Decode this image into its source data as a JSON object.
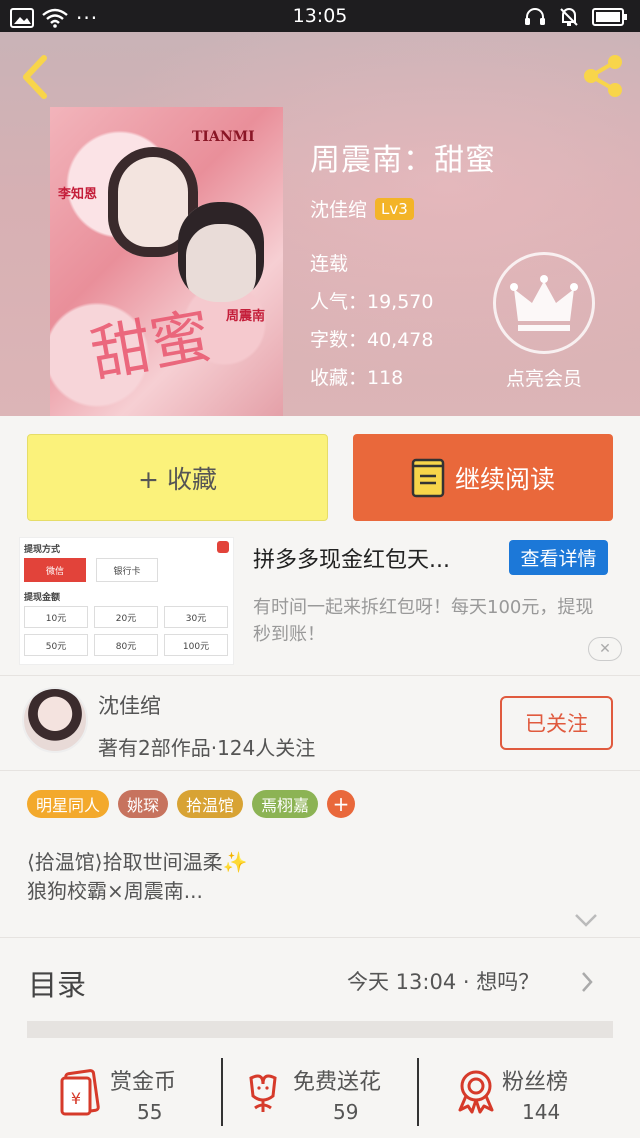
{
  "status_bar": {
    "time": "13:05",
    "dots": "···"
  },
  "book": {
    "title": "周震南：甜蜜",
    "author": "沈佳绾",
    "level": "Lv3",
    "status": "连载",
    "popularity": "人气：19,570",
    "word_count": "字数：40,478",
    "favorites": "收藏：118",
    "cover_texts": {
      "brand": "TIANMI",
      "name_left": "李知恩",
      "name_right": "周震南",
      "cover_title": "甜蜜"
    }
  },
  "vip": {
    "label": "点亮会员"
  },
  "actions": {
    "favorite_label": "+ 收藏",
    "read_label": "继续阅读"
  },
  "ad": {
    "title": "拼多多现金红包天...",
    "button": "查看详情",
    "description": "有时间一起来拆红包呀！每天100元，提现秒到账！",
    "close": "✕",
    "image": {
      "method_label": "提现方式",
      "wechat": "微信",
      "bank": "银行卡",
      "amount_label": "提现金额",
      "amounts": [
        "10元",
        "20元",
        "30元",
        "50元",
        "80元",
        "100元"
      ]
    }
  },
  "author_card": {
    "name": "沈佳绾",
    "stats": "著有2部作品·124人关注",
    "follow_label": "已关注"
  },
  "tags": [
    {
      "label": "明星同人",
      "color": "#f3a92c"
    },
    {
      "label": "姚琛",
      "color": "#c7735e"
    },
    {
      "label": "拾温馆",
      "color": "#d8a334"
    },
    {
      "label": "焉栩嘉",
      "color": "#8cb354"
    }
  ],
  "description": {
    "line1": "⟨拾温馆⟩拾取世间温柔✨",
    "line2": "狼狗校霸×周震南..."
  },
  "toc": {
    "label": "目录",
    "update": "今天 13:04 · 想吗？"
  },
  "bottom": [
    {
      "label": "赏金币",
      "value": "55"
    },
    {
      "label": "免费送花",
      "value": "59"
    },
    {
      "label": "粉丝榜",
      "value": "144"
    }
  ],
  "colors": {
    "accent": "#e9683b",
    "favorite_bg": "#fbf27b",
    "ad_button": "#1c78d8",
    "icon_red": "#d63a2a"
  }
}
